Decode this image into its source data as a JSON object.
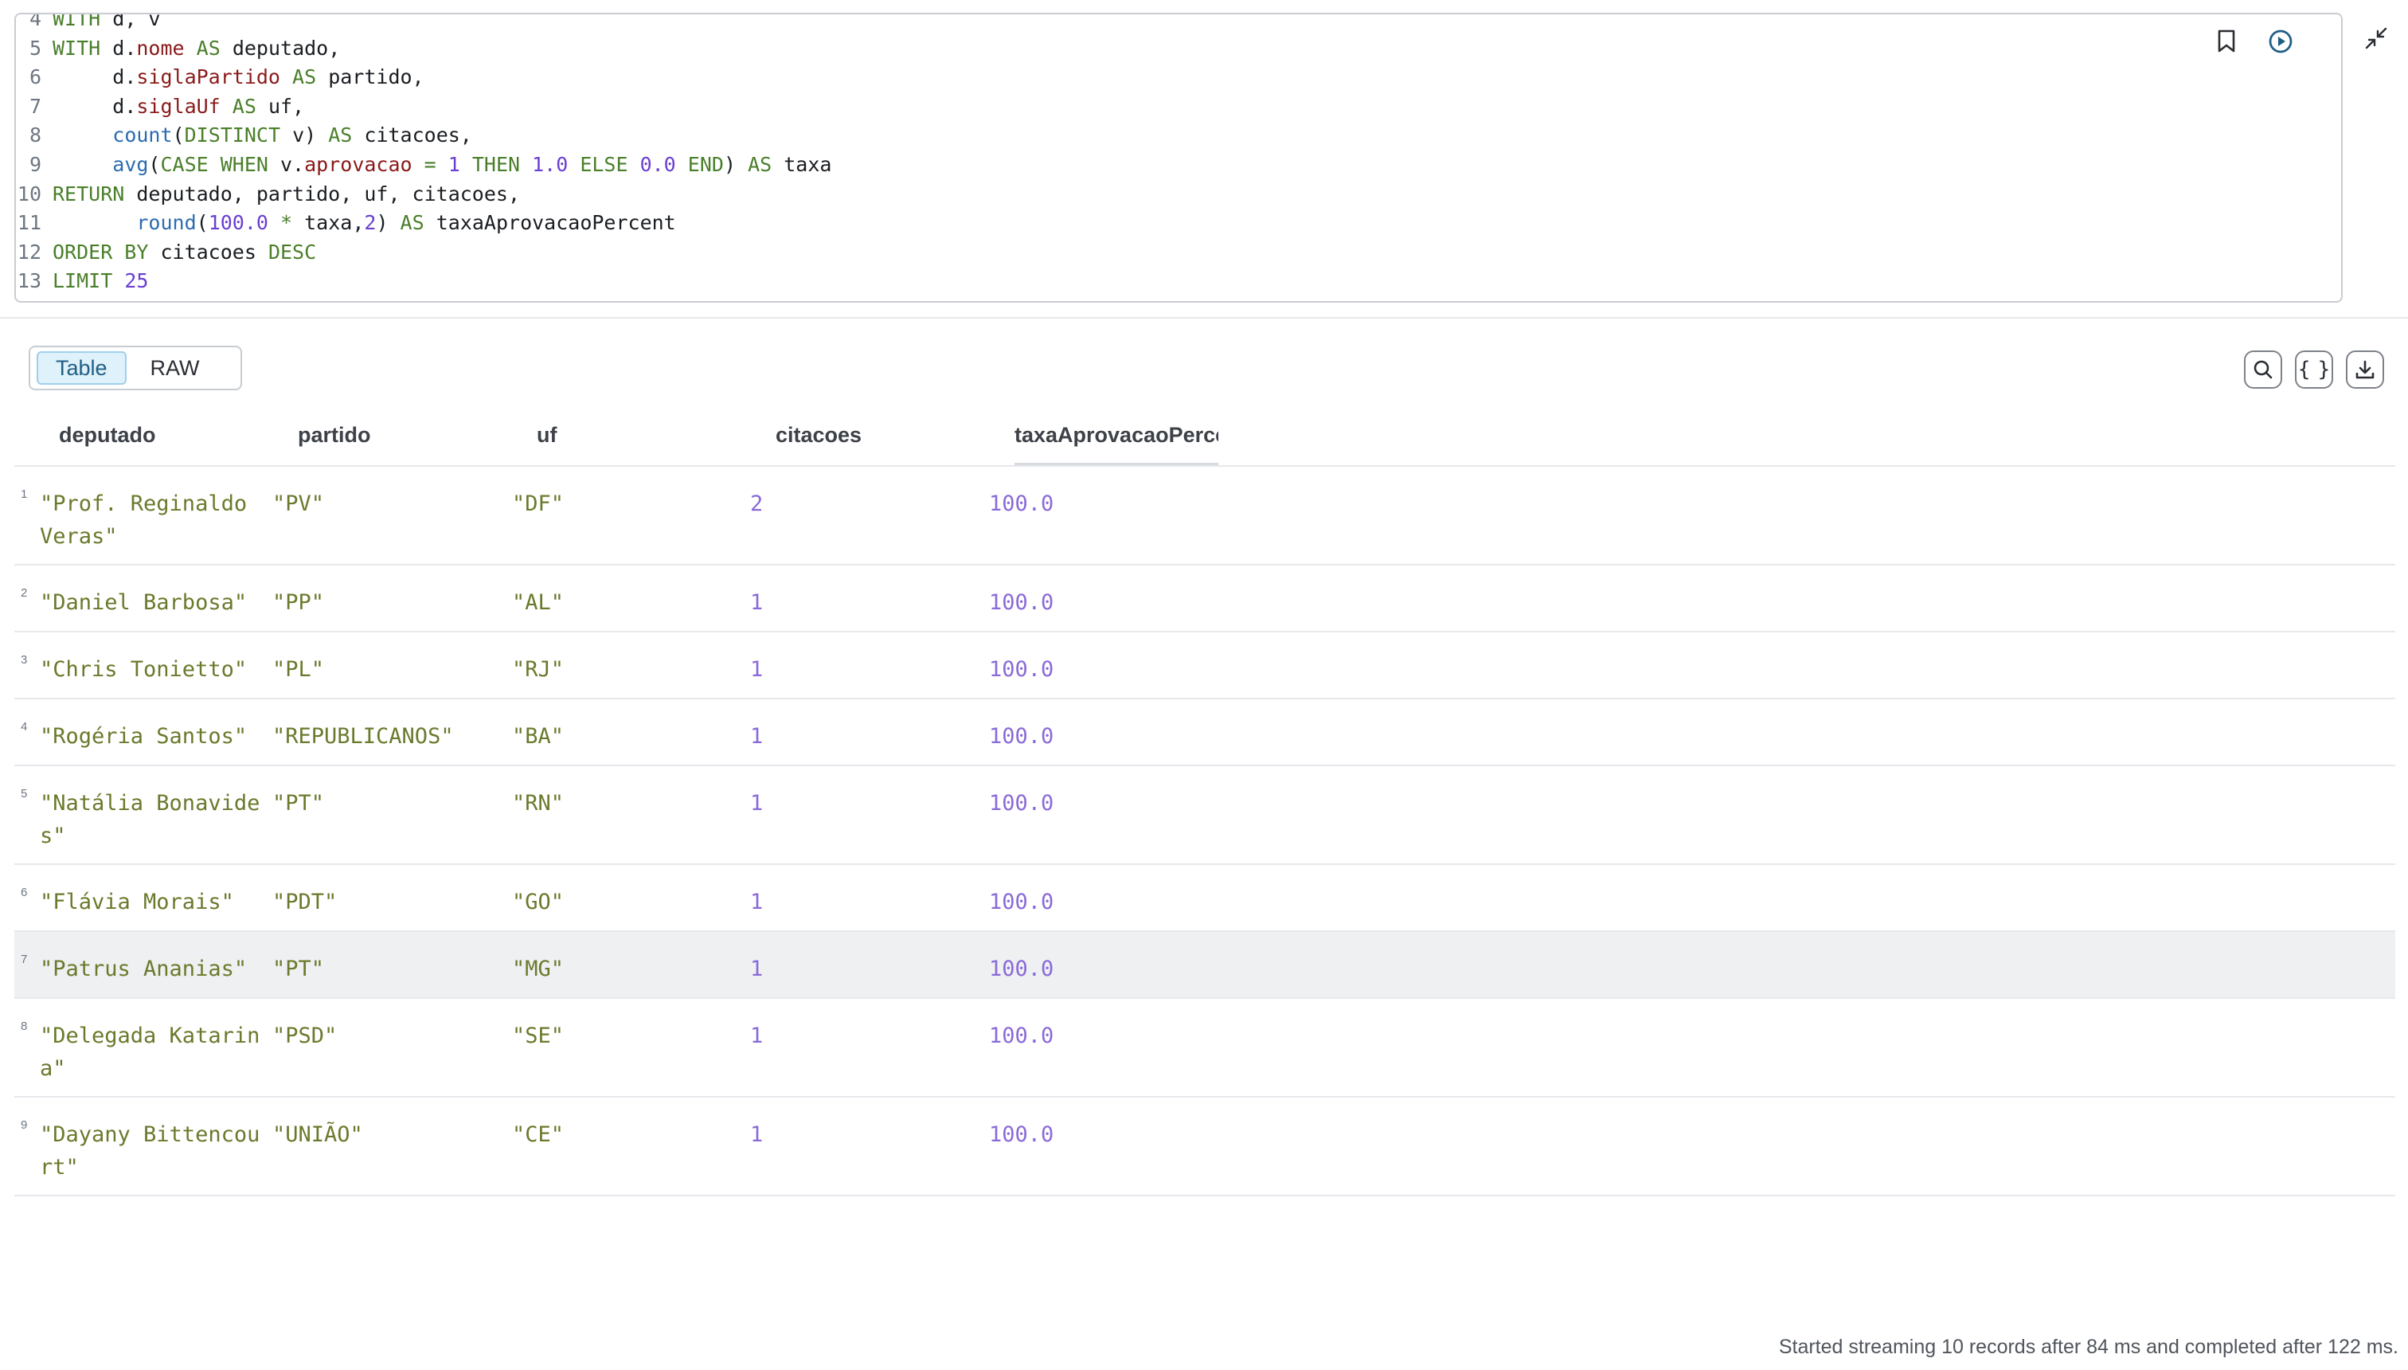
{
  "editor": {
    "lines": [
      {
        "n": "4",
        "tokens": [
          {
            "t": "WITH ",
            "c": "kw"
          },
          {
            "t": "d, v",
            "c": "plain"
          }
        ]
      },
      {
        "n": "5",
        "tokens": [
          {
            "t": "WITH ",
            "c": "kw"
          },
          {
            "t": "d.",
            "c": "plain"
          },
          {
            "t": "nome",
            "c": "prop"
          },
          {
            "t": " AS ",
            "c": "kw"
          },
          {
            "t": "deputado,",
            "c": "plain"
          }
        ]
      },
      {
        "n": "6",
        "tokens": [
          {
            "t": "     d.",
            "c": "plain"
          },
          {
            "t": "siglaPartido",
            "c": "prop"
          },
          {
            "t": " AS ",
            "c": "kw"
          },
          {
            "t": "partido,",
            "c": "plain"
          }
        ]
      },
      {
        "n": "7",
        "tokens": [
          {
            "t": "     d.",
            "c": "plain"
          },
          {
            "t": "siglaUf",
            "c": "prop"
          },
          {
            "t": " AS ",
            "c": "kw"
          },
          {
            "t": "uf,",
            "c": "plain"
          }
        ]
      },
      {
        "n": "8",
        "tokens": [
          {
            "t": "     ",
            "c": "plain"
          },
          {
            "t": "count",
            "c": "fn"
          },
          {
            "t": "(",
            "c": "plain"
          },
          {
            "t": "DISTINCT",
            "c": "kw"
          },
          {
            "t": " v) ",
            "c": "plain"
          },
          {
            "t": "AS",
            "c": "kw"
          },
          {
            "t": " citacoes,",
            "c": "plain"
          }
        ]
      },
      {
        "n": "9",
        "tokens": [
          {
            "t": "     ",
            "c": "plain"
          },
          {
            "t": "avg",
            "c": "fn"
          },
          {
            "t": "(",
            "c": "plain"
          },
          {
            "t": "CASE WHEN",
            "c": "kw"
          },
          {
            "t": " v.",
            "c": "plain"
          },
          {
            "t": "aprovacao",
            "c": "prop"
          },
          {
            "t": " = ",
            "c": "kw"
          },
          {
            "t": "1",
            "c": "num"
          },
          {
            "t": " THEN ",
            "c": "kw"
          },
          {
            "t": "1.0",
            "c": "num"
          },
          {
            "t": " ELSE ",
            "c": "kw"
          },
          {
            "t": "0.0",
            "c": "num"
          },
          {
            "t": " END",
            "c": "kw"
          },
          {
            "t": ") ",
            "c": "plain"
          },
          {
            "t": "AS",
            "c": "kw"
          },
          {
            "t": " taxa",
            "c": "plain"
          }
        ]
      },
      {
        "n": "10",
        "tokens": [
          {
            "t": "RETURN",
            "c": "kw"
          },
          {
            "t": " deputado, partido, uf, citacoes,",
            "c": "plain"
          }
        ]
      },
      {
        "n": "11",
        "tokens": [
          {
            "t": "       ",
            "c": "plain"
          },
          {
            "t": "round",
            "c": "fn"
          },
          {
            "t": "(",
            "c": "plain"
          },
          {
            "t": "100.0",
            "c": "num"
          },
          {
            "t": " * ",
            "c": "kw"
          },
          {
            "t": "taxa,",
            "c": "plain"
          },
          {
            "t": "2",
            "c": "num"
          },
          {
            "t": ") ",
            "c": "plain"
          },
          {
            "t": "AS",
            "c": "kw"
          },
          {
            "t": " taxaAprovacaoPercent",
            "c": "plain"
          }
        ]
      },
      {
        "n": "12",
        "tokens": [
          {
            "t": "ORDER BY",
            "c": "kw"
          },
          {
            "t": " citacoes ",
            "c": "plain"
          },
          {
            "t": "DESC",
            "c": "kw"
          }
        ]
      },
      {
        "n": "13",
        "tokens": [
          {
            "t": "LIMIT",
            "c": "kw"
          },
          {
            "t": " ",
            "c": "plain"
          },
          {
            "t": "25",
            "c": "num"
          }
        ]
      }
    ],
    "icons": [
      "bookmark-icon",
      "run-icon",
      "collapse-icon"
    ]
  },
  "view_toggle": {
    "table_label": "Table",
    "raw_label": "RAW",
    "selected": "Table"
  },
  "tools": {
    "search": "search-icon",
    "json": "{ }",
    "download": "download-icon"
  },
  "table": {
    "columns": [
      "deputado",
      "partido",
      "uf",
      "citacoes",
      "taxaAprovacaoPercent"
    ],
    "rows": [
      {
        "n": "1",
        "deputado": "\"Prof. Reginaldo Veras\"",
        "partido": "\"PV\"",
        "uf": "\"DF\"",
        "citacoes": "2",
        "taxa": "100.0"
      },
      {
        "n": "2",
        "deputado": "\"Daniel Barbosa\"",
        "partido": "\"PP\"",
        "uf": "\"AL\"",
        "citacoes": "1",
        "taxa": "100.0"
      },
      {
        "n": "3",
        "deputado": "\"Chris Tonietto\"",
        "partido": "\"PL\"",
        "uf": "\"RJ\"",
        "citacoes": "1",
        "taxa": "100.0"
      },
      {
        "n": "4",
        "deputado": "\"Rogéria Santos\"",
        "partido": "\"REPUBLICANOS\"",
        "uf": "\"BA\"",
        "citacoes": "1",
        "taxa": "100.0"
      },
      {
        "n": "5",
        "deputado": "\"Natália Bonavides\"",
        "partido": "\"PT\"",
        "uf": "\"RN\"",
        "citacoes": "1",
        "taxa": "100.0"
      },
      {
        "n": "6",
        "deputado": "\"Flávia Morais\"",
        "partido": "\"PDT\"",
        "uf": "\"GO\"",
        "citacoes": "1",
        "taxa": "100.0"
      },
      {
        "n": "7",
        "deputado": "\"Patrus Ananias\"",
        "partido": "\"PT\"",
        "uf": "\"MG\"",
        "citacoes": "1",
        "taxa": "100.0"
      },
      {
        "n": "8",
        "deputado": "\"Delegada Katarina\"",
        "partido": "\"PSD\"",
        "uf": "\"SE\"",
        "citacoes": "1",
        "taxa": "100.0"
      },
      {
        "n": "9",
        "deputado": "\"Dayany Bittencourt\"",
        "partido": "\"UNIÃO\"",
        "uf": "\"CE\"",
        "citacoes": "1",
        "taxa": "100.0"
      }
    ]
  },
  "status": "Started streaming 10 records after 84 ms and completed after 122 ms."
}
